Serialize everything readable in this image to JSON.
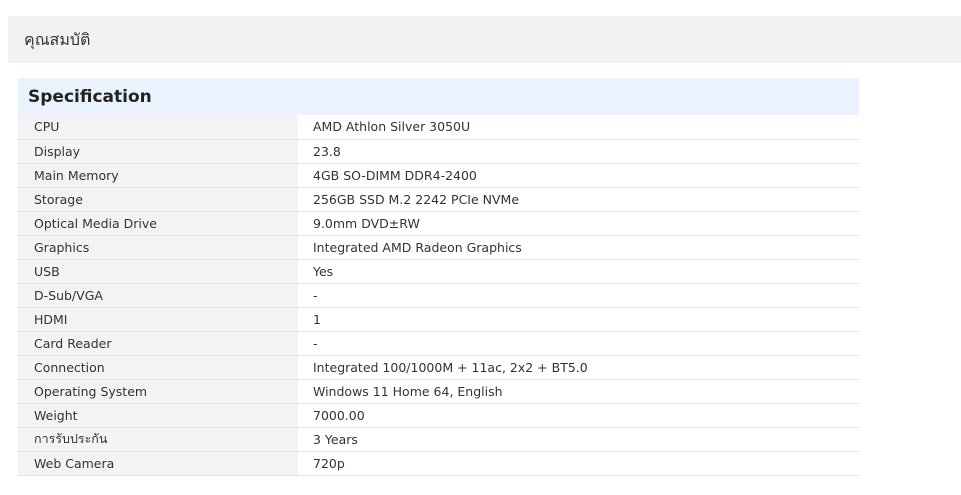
{
  "section": {
    "title": "คุณสมบัติ"
  },
  "spec": {
    "heading": "Specification",
    "rows": [
      {
        "label": "CPU",
        "value": "AMD Athlon Silver 3050U"
      },
      {
        "label": "Display",
        "value": "23.8"
      },
      {
        "label": "Main Memory",
        "value": "4GB SO-DIMM DDR4-2400"
      },
      {
        "label": "Storage",
        "value": "256GB SSD M.2 2242 PCIe NVMe"
      },
      {
        "label": "Optical Media Drive",
        "value": "9.0mm DVD±RW"
      },
      {
        "label": "Graphics",
        "value": "Integrated AMD Radeon Graphics"
      },
      {
        "label": "USB",
        "value": "Yes"
      },
      {
        "label": "D-Sub/VGA",
        "value": "-"
      },
      {
        "label": "HDMI",
        "value": "1"
      },
      {
        "label": "Card Reader",
        "value": "-"
      },
      {
        "label": "Connection",
        "value": "Integrated 100/1000M + 11ac, 2x2 + BT5.0"
      },
      {
        "label": "Operating System",
        "value": "Windows 11 Home 64, English"
      },
      {
        "label": "Weight",
        "value": "7000.00"
      },
      {
        "label": "การรับประกัน",
        "value": "3 Years"
      },
      {
        "label": "Web Camera",
        "value": "720p"
      }
    ]
  }
}
